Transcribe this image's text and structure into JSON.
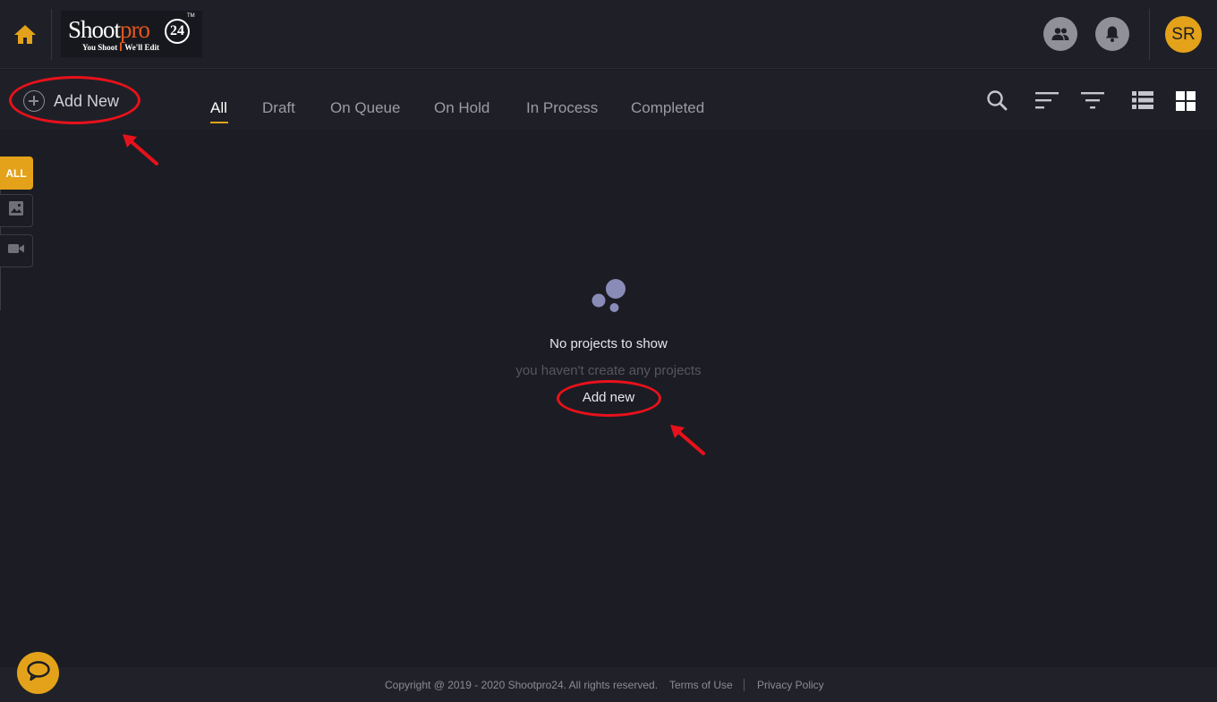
{
  "colors": {
    "accent": "#e3a21a",
    "background": "#1c1d24",
    "annotation": "#e8111b"
  },
  "header": {
    "logo": {
      "main": "Shootpro",
      "number": "24",
      "tm": "TM",
      "tagline_left": "You Shoot",
      "tagline_right": "We'll Edit"
    },
    "icons": [
      "home-icon",
      "team-icon",
      "bell-icon"
    ],
    "avatar_initials": "SR"
  },
  "toolbar": {
    "add_new_label": "Add New",
    "tabs": [
      {
        "label": "All",
        "active": true
      },
      {
        "label": "Draft",
        "active": false
      },
      {
        "label": "On Queue",
        "active": false
      },
      {
        "label": "On Hold",
        "active": false
      },
      {
        "label": "In Process",
        "active": false
      },
      {
        "label": "Completed",
        "active": false
      }
    ],
    "tool_icons": [
      "search-icon",
      "sort-icon",
      "filter-icon",
      "list-view-icon",
      "grid-view-icon"
    ]
  },
  "filter_rail": {
    "items": [
      {
        "label": "ALL",
        "active": true
      },
      {
        "icon": "image-icon",
        "active": false
      },
      {
        "icon": "video-icon",
        "active": false
      }
    ]
  },
  "empty_state": {
    "title": "No projects to show",
    "subtitle": "you haven't create any projects",
    "action_label": "Add new"
  },
  "footer": {
    "copyright": "Copyright @ 2019 - 2020 Shootpro24. All rights reserved.",
    "terms": "Terms of Use",
    "privacy": "Privacy Policy"
  },
  "chat": {
    "icon": "chat-icon"
  }
}
